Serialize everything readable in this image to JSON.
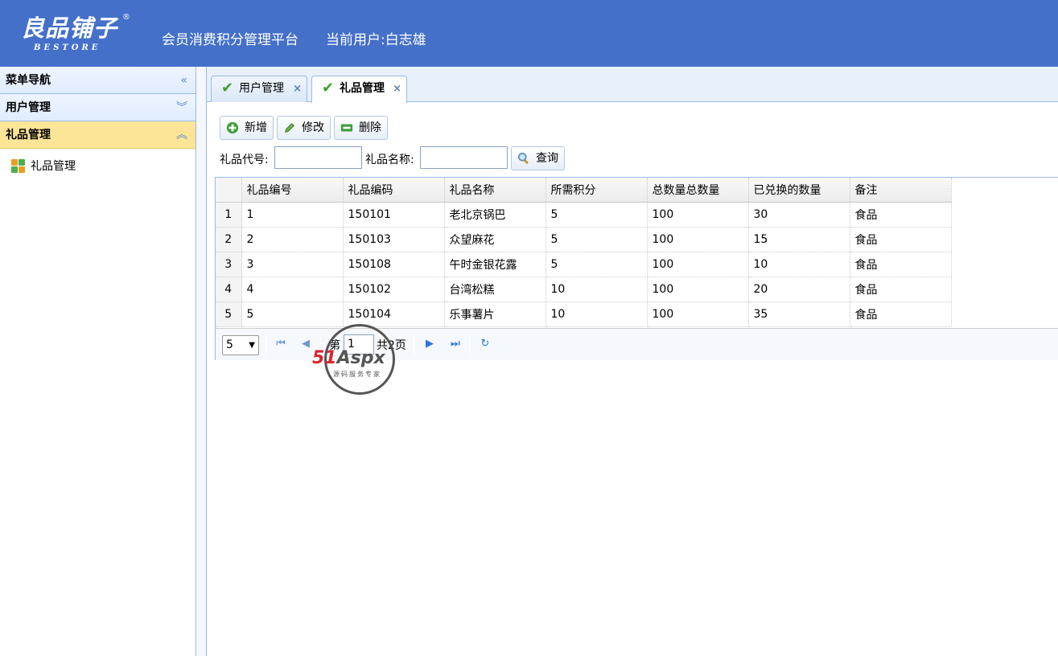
{
  "header": {
    "logo_text": "良品铺子",
    "logo_registered": "®",
    "logo_sub": "BESTORE",
    "title": "会员消费积分管理平台",
    "current_user": "当前用户:白志雄",
    "bg_color": "#4470c9"
  },
  "sidebar": {
    "nav_title": "菜单导航",
    "nav_icon": "double-chevron-left-icon",
    "groups": [
      {
        "label": "用户管理",
        "icon": "double-chevron-down-icon",
        "expanded": false
      },
      {
        "label": "礼品管理",
        "icon": "double-chevron-up-icon",
        "expanded": true
      }
    ],
    "tree_items": [
      {
        "label": "礼品管理",
        "icon": "grid-modules-icon"
      }
    ]
  },
  "tabs": [
    {
      "label": "用户管理",
      "active": false,
      "icon": "checkmark-icon"
    },
    {
      "label": "礼品管理",
      "active": true,
      "icon": "checkmark-icon"
    }
  ],
  "toolbar": {
    "add_label": "新增",
    "edit_label": "修改",
    "delete_label": "删除"
  },
  "search": {
    "code_label": "礼品代号:",
    "code_value": "",
    "name_label": "礼品名称:",
    "name_value": "",
    "query_label": "查询"
  },
  "grid": {
    "columns": [
      "礼品编号",
      "礼品编码",
      "礼品名称",
      "所需积分",
      "总数量总数量",
      "已兑换的数量",
      "备注"
    ],
    "rows": [
      {
        "rn": "1",
        "cells": [
          "1",
          "150101",
          "老北京锅巴",
          "5",
          "100",
          "30",
          "食品"
        ]
      },
      {
        "rn": "2",
        "cells": [
          "2",
          "150103",
          "众望麻花",
          "5",
          "100",
          "15",
          "食品"
        ]
      },
      {
        "rn": "3",
        "cells": [
          "3",
          "150108",
          "午时金银花露",
          "5",
          "100",
          "10",
          "食品"
        ]
      },
      {
        "rn": "4",
        "cells": [
          "4",
          "150102",
          "台湾松糕",
          "10",
          "100",
          "20",
          "食品"
        ]
      },
      {
        "rn": "5",
        "cells": [
          "5",
          "150104",
          "乐事薯片",
          "10",
          "100",
          "35",
          "食品"
        ]
      }
    ]
  },
  "pager": {
    "page_size": "5",
    "page_prefix": "第",
    "current_page": "1",
    "total_text": "共2页"
  },
  "watermark": {
    "brand_red": "51",
    "brand_gray": "Aspx",
    "tagline": "源码服务专家"
  }
}
